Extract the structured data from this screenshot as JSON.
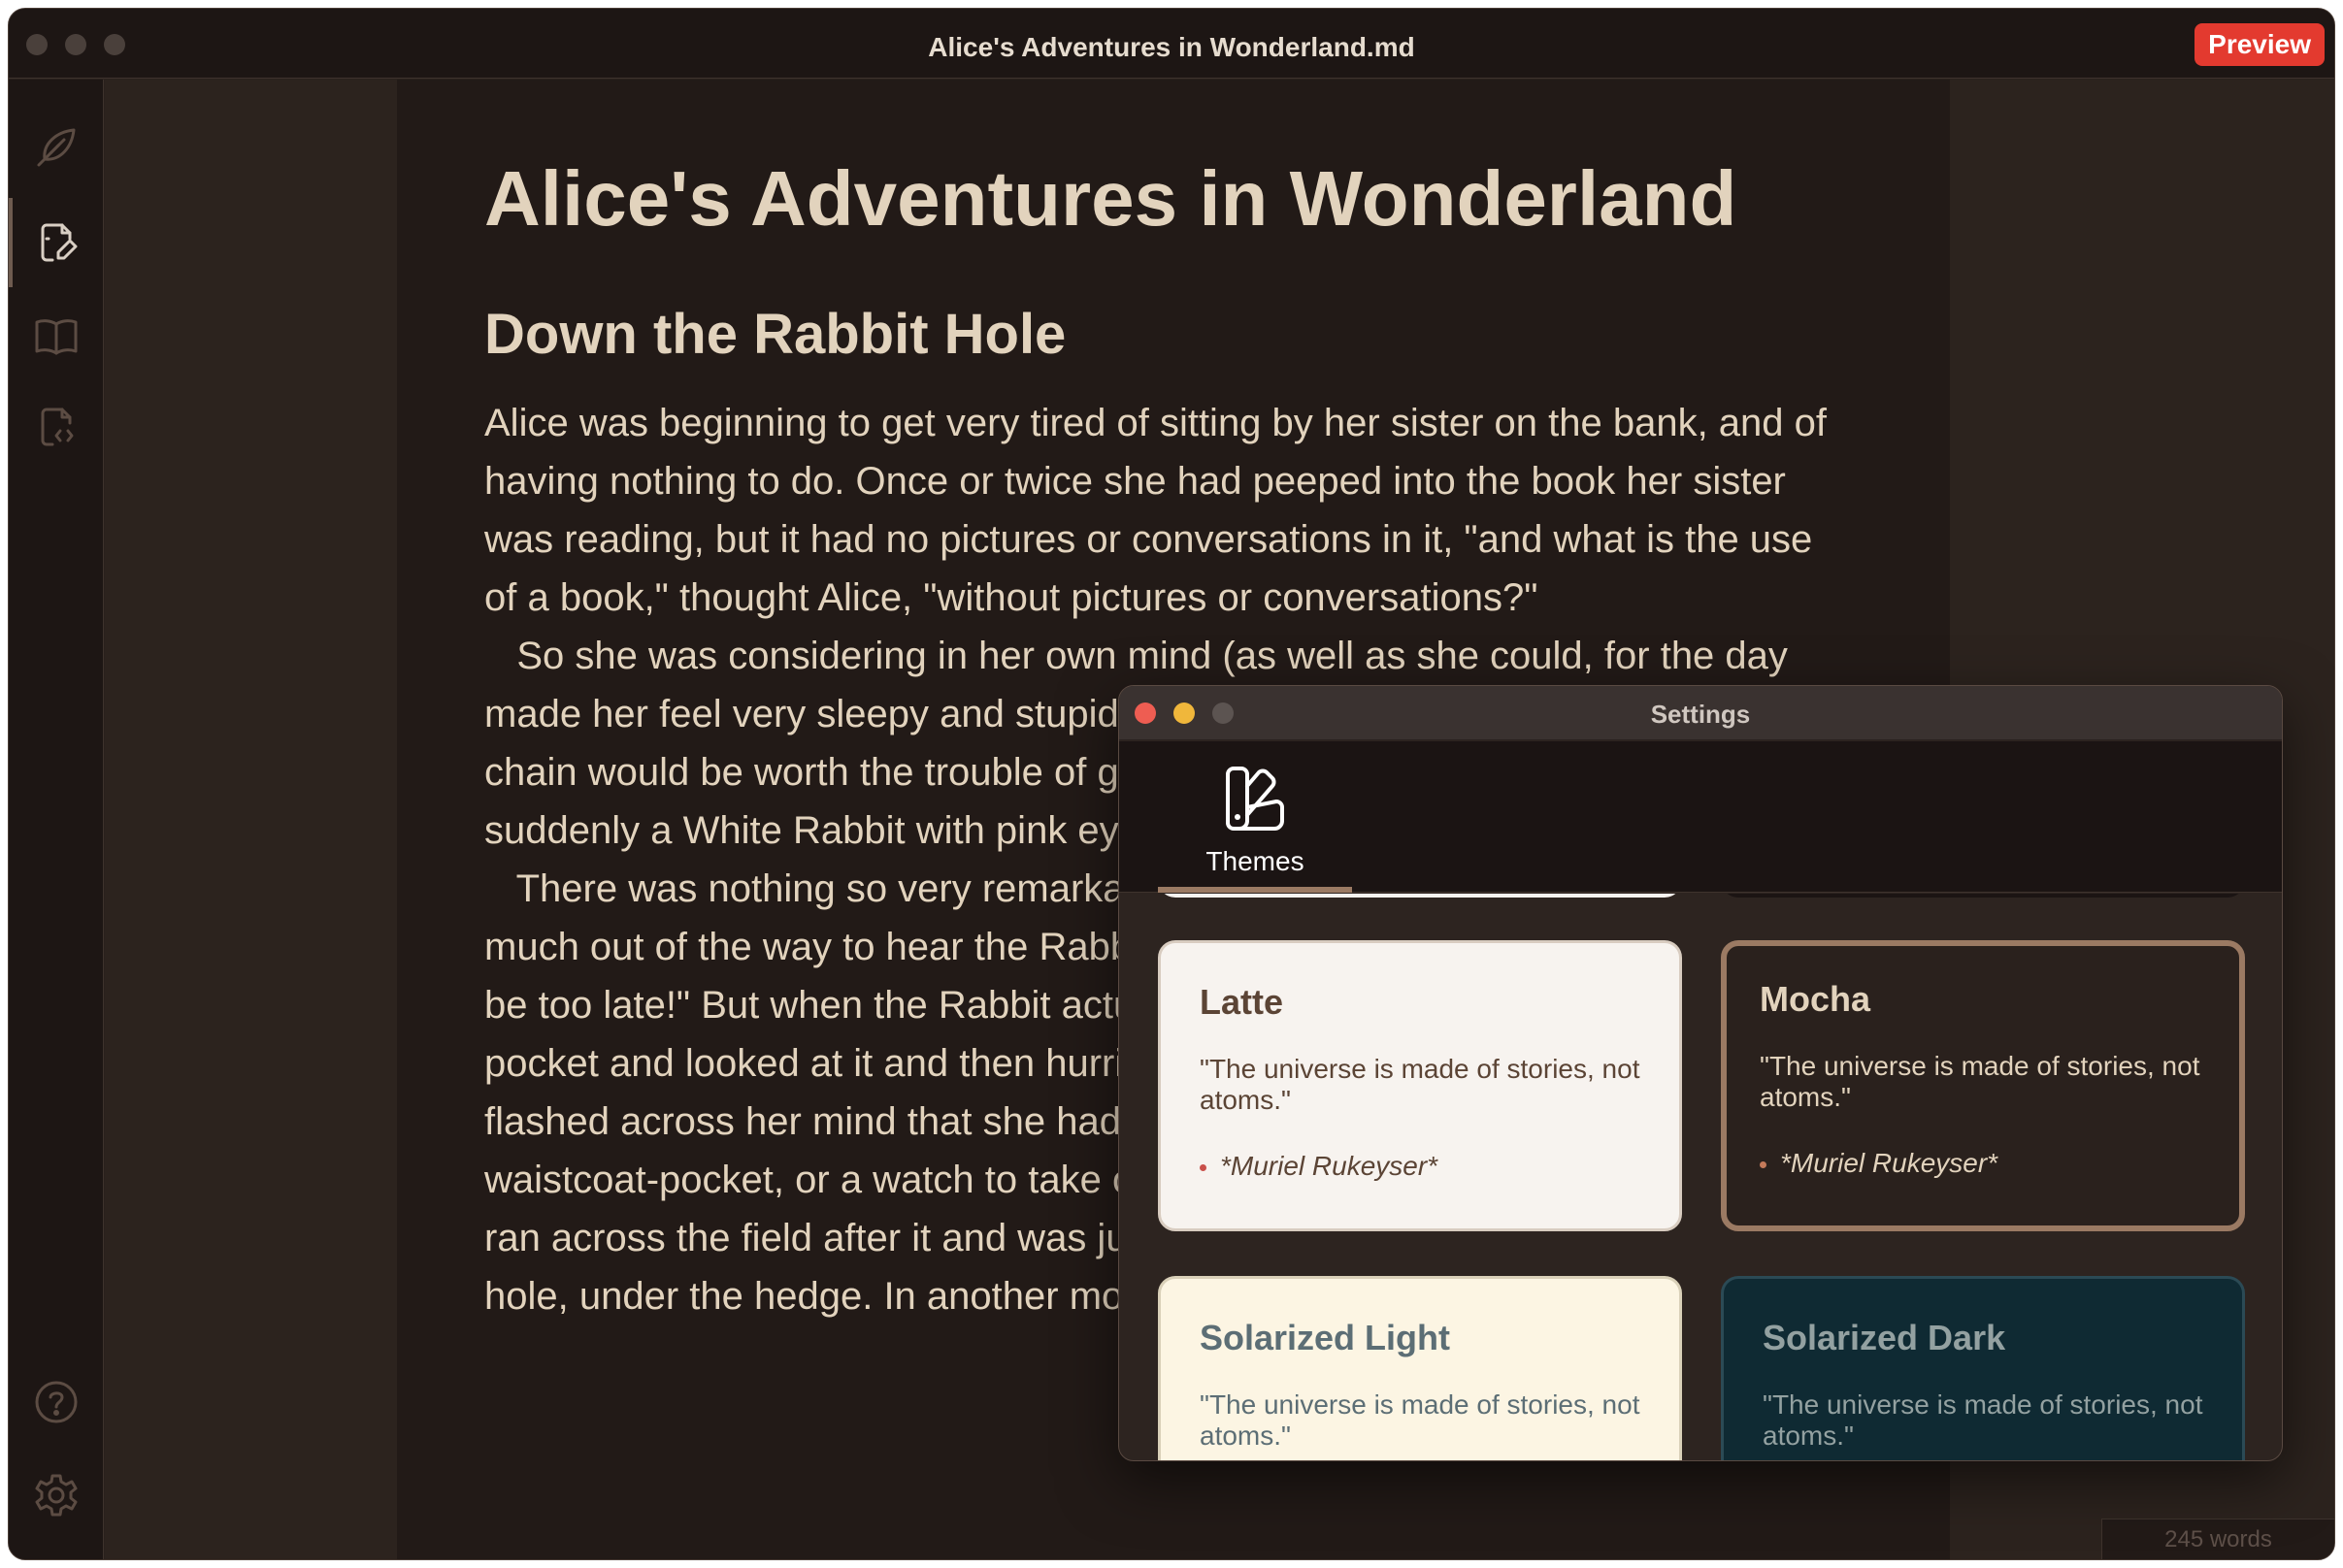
{
  "window": {
    "title": "Alice's Adventures in Wonderland.md",
    "preview_label": "Preview"
  },
  "sidebar": {
    "items": [
      {
        "icon": "feather-icon"
      },
      {
        "icon": "edit-document-icon",
        "active": true
      },
      {
        "icon": "book-icon"
      },
      {
        "icon": "code-document-icon"
      }
    ],
    "bottom": [
      {
        "icon": "help-icon"
      },
      {
        "icon": "gear-icon"
      }
    ]
  },
  "document": {
    "h1": "Alice's Adventures in Wonderland",
    "h2": "Down the Rabbit Hole",
    "lines": [
      "Alice was beginning to get very tired of sitting by her sister on the bank, and of",
      "having nothing to do. Once or twice she had peeped into the book her sister",
      "was reading, but it had no pictures or conversations in it, \"and what is the use",
      "of a book,\" thought Alice, \"without pictures or conversations?\"",
      "   So she was considering in her own mind (as well as she could, for the day",
      "made her feel very sleepy and stupid",
      "chain would be worth the trouble of g",
      "suddenly a White Rabbit with pink ey",
      "   There was nothing so very remarka",
      "much out of the way to hear the Rabb",
      "be too late!\" But when the Rabbit actu",
      "pocket and looked at it and then hurri",
      "flashed across her mind that she had",
      "waistcoat-pocket, or a watch to take o",
      "ran across the field after it and was ju",
      "hole, under the hedge. In another mo"
    ],
    "word_count": "245 words"
  },
  "settings": {
    "title": "Settings",
    "tab_label": "Themes",
    "themes": [
      {
        "name": "Latte",
        "quote": "\"The universe is made of stories, not atoms.\"",
        "author": "*Muriel Rukeyser*",
        "selected": false
      },
      {
        "name": "Mocha",
        "quote": "\"The universe is made of stories, not atoms.\"",
        "author": "*Muriel Rukeyser*",
        "selected": true
      },
      {
        "name": "Solarized Light",
        "quote": "\"The universe is made of stories, not atoms.\""
      },
      {
        "name": "Solarized Dark",
        "quote": "\"The universe is made of stories, not atoms.\""
      }
    ]
  },
  "colors": {
    "accent": "#e33a2f",
    "text": "#e2d3bd",
    "selected_border": "#9b7a63"
  }
}
